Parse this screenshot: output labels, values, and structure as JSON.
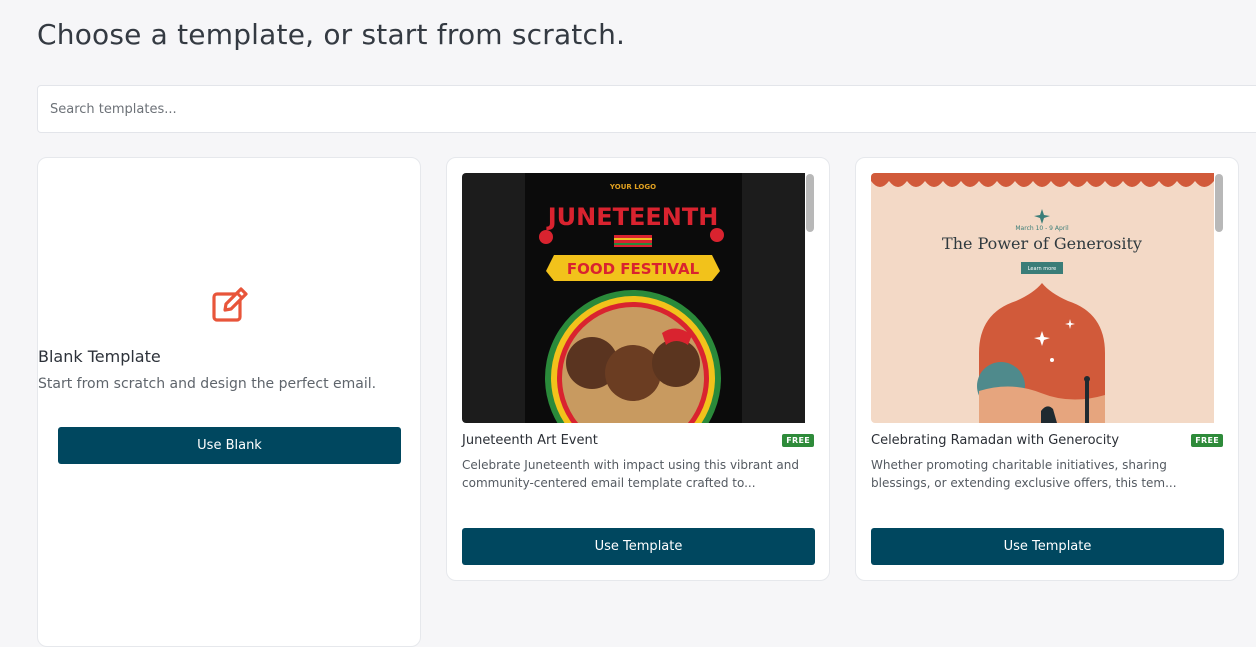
{
  "page": {
    "title": "Choose a template, or start from scratch."
  },
  "search": {
    "placeholder": "Search templates..."
  },
  "blank_card": {
    "icon": "edit-icon",
    "title": "Blank Template",
    "subtitle": "Start from scratch and design the perfect email.",
    "button_label": "Use Blank"
  },
  "templates": [
    {
      "title": "Juneteenth Art Event",
      "badge": "FREE",
      "description_line1": "Celebrate Juneteenth with impact using this vibrant and",
      "description_line2": "community-centered email template crafted to...",
      "button_label": "Use Template",
      "thumb": {
        "logo": "YOUR LOGO",
        "headline": "JUNETEENTH",
        "banner": "FOOD FESTIVAL"
      }
    },
    {
      "title": "Celebrating Ramadan with Generocity",
      "badge": "FREE",
      "description_line1": "Whether promoting charitable initiatives, sharing",
      "description_line2": "blessings, or extending exclusive offers, this tem...",
      "button_label": "Use Template",
      "thumb": {
        "date": "March 10 - 9 April",
        "headline": "The Power of Generosity",
        "cta": "Learn more"
      }
    }
  ],
  "colors": {
    "accent_button": "#00475f",
    "edit_icon": "#e8553a",
    "free_badge": "#2e8b3a"
  }
}
